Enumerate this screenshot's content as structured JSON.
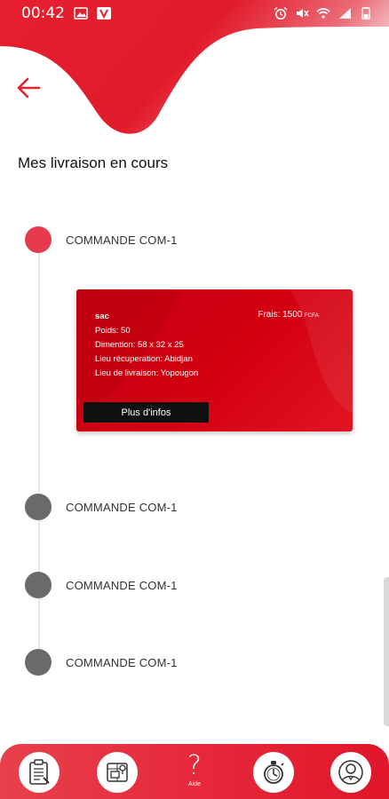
{
  "status_bar": {
    "time": "00:42"
  },
  "header": {
    "title": "Mes livraison en cours"
  },
  "orders": [
    {
      "label": "COMMANDE COM-1",
      "active": true
    },
    {
      "label": "COMMANDE COM-1",
      "active": false
    },
    {
      "label": "COMMANDE COM-1",
      "active": false
    },
    {
      "label": "COMMANDE COM-1",
      "active": false
    }
  ],
  "detail": {
    "name": "sac",
    "weight": "Poids: 50",
    "dimension": "Dimention: 58 x 32 x 25",
    "pickup": "Lieu récuperation: Abidjan",
    "delivery": "Lieu de livraison: Yopougon",
    "fee": "Frais: 1500",
    "fee_unit": "FCFA",
    "more_button": "Plus d'infos"
  },
  "bottom_nav": {
    "help_label": "Aide",
    "help_glyph": "?",
    "icons": [
      "clipboard-icon",
      "delivery-map-icon",
      "help-icon",
      "stopwatch-icon",
      "profile-icon"
    ]
  },
  "colors": {
    "brand_red": "#e0162a",
    "card_red": "#c60012",
    "active_dot": "#e83a4f",
    "inactive_dot": "#6a6a6a"
  }
}
